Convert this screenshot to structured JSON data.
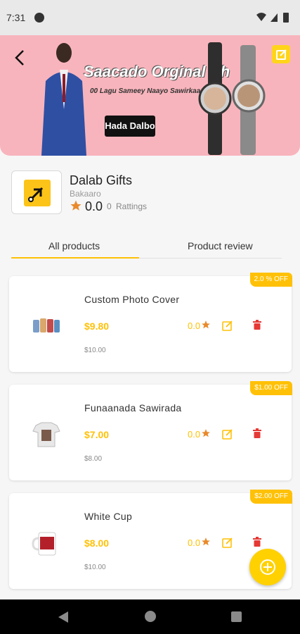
{
  "status_bar": {
    "time": "7:31"
  },
  "banner": {
    "title": "Saacado Orginal Ah",
    "subtitle": "00 Lagu Sameey Naayo Sawirkaaga",
    "cta": "Hada Dalbo"
  },
  "store": {
    "name": "Dalab Gifts",
    "location": "Bakaaro",
    "rating": "0.0",
    "rating_count": "0",
    "rating_label": "Rattings"
  },
  "tabs": [
    {
      "label": "All products",
      "active": true
    },
    {
      "label": "Product review",
      "active": false
    }
  ],
  "products": [
    {
      "name": "Custom Photo Cover",
      "price": "$9.80",
      "old_price": "$10.00",
      "rating": "0.0",
      "discount": "2.0 % OFF"
    },
    {
      "name": "Funaanada Sawirada",
      "price": "$7.00",
      "old_price": "$8.00",
      "rating": "0.0",
      "discount": "$1.00 OFF"
    },
    {
      "name": "White Cup",
      "price": "$8.00",
      "old_price": "$10.00",
      "rating": "0.0",
      "discount": "$2.00 OFF"
    }
  ],
  "colors": {
    "accent": "#ffc107",
    "banner_bg": "#f8b4bc",
    "danger": "#e53935"
  }
}
